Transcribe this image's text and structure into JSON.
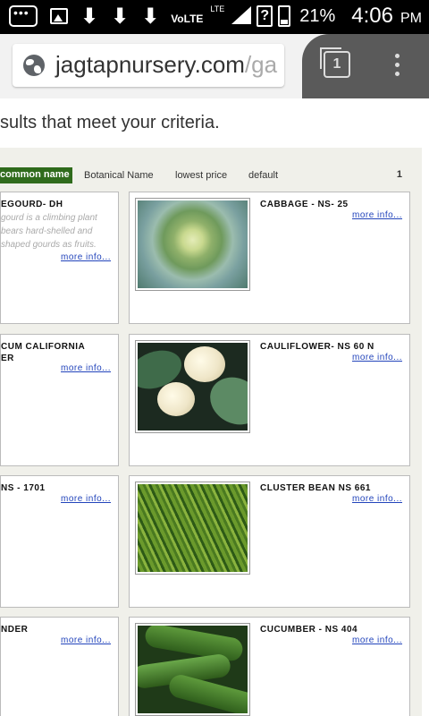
{
  "status_bar": {
    "network": "VoLTE",
    "network_type": "LTE",
    "battery": "21%",
    "time": "4:06",
    "ampm": "PM"
  },
  "browser": {
    "url_domain": "jagtapnursery.com",
    "url_rest": "/ga",
    "tab_count": "1"
  },
  "page": {
    "criteria_text": "sults that meet your criteria."
  },
  "sort": {
    "active": "common name",
    "botanical": "Botanical Name",
    "price": "lowest price",
    "default": "default",
    "page_number": "1"
  },
  "products_left": [
    {
      "title": "EGOURD- DH",
      "desc": [
        "gourd is a climbing plant",
        "bears hard-shelled and",
        "shaped gourds as fruits."
      ],
      "more": "more info..."
    },
    {
      "title": "CUM CALIFORNIA",
      "title2": "ER",
      "more": "more info..."
    },
    {
      "title": " NS - 1701",
      "more": "more info..."
    },
    {
      "title": "NDER",
      "more": "more info..."
    }
  ],
  "products_right": [
    {
      "title": "CABBAGE - NS- 25",
      "more": "more info...",
      "image": "cabbage"
    },
    {
      "title": "CAULIFLOWER- NS 60 N",
      "more": "more info...",
      "image": "cauliflower"
    },
    {
      "title": "CLUSTER BEAN NS 661",
      "more": "more info...",
      "image": "cluster-beans"
    },
    {
      "title": "CUCUMBER - NS 404",
      "more": "more info...",
      "image": "cucumber"
    }
  ],
  "colors": {
    "sort_active_bg": "#2f6b1c",
    "link": "#2244bb",
    "results_bg": "#f0f0ea"
  }
}
